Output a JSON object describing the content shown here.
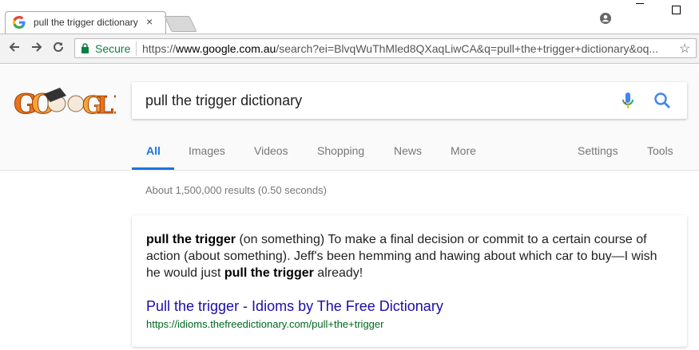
{
  "browser": {
    "tab_title": "pull the trigger dictionary",
    "tab_close": "×",
    "secure_label": "Secure",
    "url_scheme": "https://",
    "url_host": "www.google.com.au",
    "url_rest": "/search?ei=BlvqWuThMled8QXaqLiwCA&q=pull+the+trigger+dictionary&oq...",
    "star": "☆"
  },
  "search": {
    "query": "pull the trigger dictionary",
    "tabs": [
      "All",
      "Images",
      "Videos",
      "Shopping",
      "News",
      "More"
    ],
    "tools": [
      "Settings",
      "Tools"
    ],
    "stats": "About 1,500,000 results (0.50 seconds)"
  },
  "result": {
    "def_bold1": "pull the trigger",
    "def_text1": " (on something) To make a final decision or commit to a certain course of action (about something). Jeff's been hemming and hawing about which car to buy—I wish he would just ",
    "def_bold2": "pull the trigger",
    "def_text2": " already!",
    "title": "Pull the trigger - Idioms by The Free Dictionary",
    "url": "https://idioms.thefreedictionary.com/pull+the+trigger"
  },
  "colors": {
    "accent": "#1a73e8",
    "link": "#1a0dab",
    "url_green": "#006621"
  }
}
